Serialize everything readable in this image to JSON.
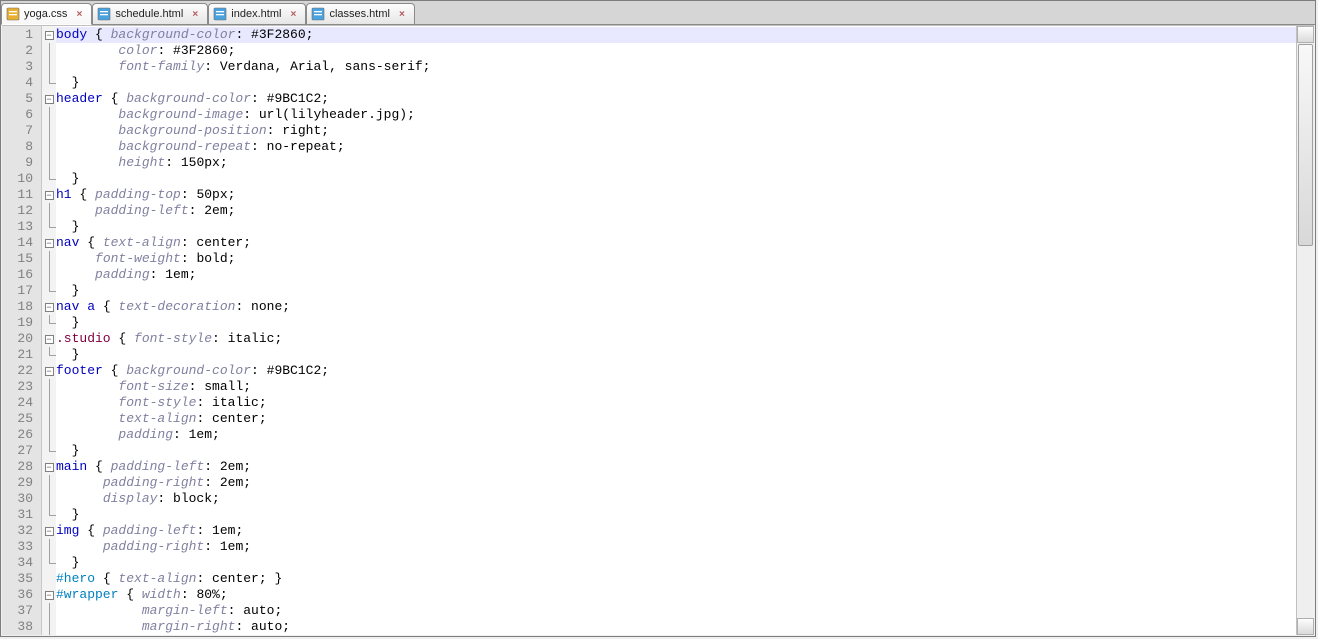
{
  "tabs": [
    {
      "name": "yoga.css",
      "active": true,
      "icontype": "css"
    },
    {
      "name": "schedule.html",
      "active": false,
      "icontype": "html"
    },
    {
      "name": "index.html",
      "active": false,
      "icontype": "html"
    },
    {
      "name": "classes.html",
      "active": false,
      "icontype": "html"
    }
  ],
  "line_count": 38,
  "code_lines": [
    {
      "n": 1,
      "fold": "open",
      "tokens": [
        [
          "sel",
          "body"
        ],
        [
          "plain",
          " { "
        ],
        [
          "prop",
          "background-color"
        ],
        [
          "plain",
          ": #3F2860;"
        ]
      ]
    },
    {
      "n": 2,
      "fold": "mid",
      "tokens": [
        [
          "plain",
          "        "
        ],
        [
          "prop",
          "color"
        ],
        [
          "plain",
          ": #3F2860;"
        ]
      ]
    },
    {
      "n": 3,
      "fold": "mid",
      "tokens": [
        [
          "plain",
          "        "
        ],
        [
          "prop",
          "font-family"
        ],
        [
          "plain",
          ": Verdana, Arial, sans-serif;"
        ]
      ]
    },
    {
      "n": 4,
      "fold": "end",
      "tokens": [
        [
          "plain",
          "  }"
        ]
      ]
    },
    {
      "n": 5,
      "fold": "open",
      "tokens": [
        [
          "sel",
          "header"
        ],
        [
          "plain",
          " { "
        ],
        [
          "prop",
          "background-color"
        ],
        [
          "plain",
          ": #9BC1C2;"
        ]
      ]
    },
    {
      "n": 6,
      "fold": "mid",
      "tokens": [
        [
          "plain",
          "        "
        ],
        [
          "prop",
          "background-image"
        ],
        [
          "plain",
          ": url(lilyheader.jpg);"
        ]
      ]
    },
    {
      "n": 7,
      "fold": "mid",
      "tokens": [
        [
          "plain",
          "        "
        ],
        [
          "prop",
          "background-position"
        ],
        [
          "plain",
          ": right;"
        ]
      ]
    },
    {
      "n": 8,
      "fold": "mid",
      "tokens": [
        [
          "plain",
          "        "
        ],
        [
          "prop",
          "background-repeat"
        ],
        [
          "plain",
          ": no-repeat;"
        ]
      ]
    },
    {
      "n": 9,
      "fold": "mid",
      "tokens": [
        [
          "plain",
          "        "
        ],
        [
          "prop",
          "height"
        ],
        [
          "plain",
          ": 150px;"
        ]
      ]
    },
    {
      "n": 10,
      "fold": "end",
      "tokens": [
        [
          "plain",
          "  }"
        ]
      ]
    },
    {
      "n": 11,
      "fold": "open",
      "tokens": [
        [
          "sel",
          "h1"
        ],
        [
          "plain",
          " { "
        ],
        [
          "prop",
          "padding-top"
        ],
        [
          "plain",
          ": 50px;"
        ]
      ]
    },
    {
      "n": 12,
      "fold": "mid",
      "tokens": [
        [
          "plain",
          "     "
        ],
        [
          "prop",
          "padding-left"
        ],
        [
          "plain",
          ": 2em;"
        ]
      ]
    },
    {
      "n": 13,
      "fold": "end",
      "tokens": [
        [
          "plain",
          "  }"
        ]
      ]
    },
    {
      "n": 14,
      "fold": "open",
      "tokens": [
        [
          "sel",
          "nav"
        ],
        [
          "plain",
          " { "
        ],
        [
          "prop",
          "text-align"
        ],
        [
          "plain",
          ": center;"
        ]
      ]
    },
    {
      "n": 15,
      "fold": "mid",
      "tokens": [
        [
          "plain",
          "     "
        ],
        [
          "prop",
          "font-weight"
        ],
        [
          "plain",
          ": bold;"
        ]
      ]
    },
    {
      "n": 16,
      "fold": "mid",
      "tokens": [
        [
          "plain",
          "     "
        ],
        [
          "prop",
          "padding"
        ],
        [
          "plain",
          ": 1em;"
        ]
      ]
    },
    {
      "n": 17,
      "fold": "end",
      "tokens": [
        [
          "plain",
          "  }"
        ]
      ]
    },
    {
      "n": 18,
      "fold": "open",
      "tokens": [
        [
          "sel",
          "nav a"
        ],
        [
          "plain",
          " { "
        ],
        [
          "prop",
          "text-decoration"
        ],
        [
          "plain",
          ": none;"
        ]
      ]
    },
    {
      "n": 19,
      "fold": "end",
      "tokens": [
        [
          "plain",
          "  }"
        ]
      ]
    },
    {
      "n": 20,
      "fold": "open",
      "tokens": [
        [
          "cls",
          ".studio"
        ],
        [
          "plain",
          " { "
        ],
        [
          "prop",
          "font-style"
        ],
        [
          "plain",
          ": italic;"
        ]
      ]
    },
    {
      "n": 21,
      "fold": "end",
      "tokens": [
        [
          "plain",
          "  }"
        ]
      ]
    },
    {
      "n": 22,
      "fold": "open",
      "tokens": [
        [
          "sel",
          "footer"
        ],
        [
          "plain",
          " { "
        ],
        [
          "prop",
          "background-color"
        ],
        [
          "plain",
          ": #9BC1C2;"
        ]
      ]
    },
    {
      "n": 23,
      "fold": "mid",
      "tokens": [
        [
          "plain",
          "        "
        ],
        [
          "prop",
          "font-size"
        ],
        [
          "plain",
          ": small;"
        ]
      ]
    },
    {
      "n": 24,
      "fold": "mid",
      "tokens": [
        [
          "plain",
          "        "
        ],
        [
          "prop",
          "font-style"
        ],
        [
          "plain",
          ": italic;"
        ]
      ]
    },
    {
      "n": 25,
      "fold": "mid",
      "tokens": [
        [
          "plain",
          "        "
        ],
        [
          "prop",
          "text-align"
        ],
        [
          "plain",
          ": center;"
        ]
      ]
    },
    {
      "n": 26,
      "fold": "mid",
      "tokens": [
        [
          "plain",
          "        "
        ],
        [
          "prop",
          "padding"
        ],
        [
          "plain",
          ": 1em;"
        ]
      ]
    },
    {
      "n": 27,
      "fold": "end",
      "tokens": [
        [
          "plain",
          "  }"
        ]
      ]
    },
    {
      "n": 28,
      "fold": "open",
      "tokens": [
        [
          "sel",
          "main"
        ],
        [
          "plain",
          " { "
        ],
        [
          "prop",
          "padding-left"
        ],
        [
          "plain",
          ": 2em;"
        ]
      ]
    },
    {
      "n": 29,
      "fold": "mid",
      "tokens": [
        [
          "plain",
          "      "
        ],
        [
          "prop",
          "padding-right"
        ],
        [
          "plain",
          ": 2em;"
        ]
      ]
    },
    {
      "n": 30,
      "fold": "mid",
      "tokens": [
        [
          "plain",
          "      "
        ],
        [
          "prop",
          "display"
        ],
        [
          "plain",
          ": block;"
        ]
      ]
    },
    {
      "n": 31,
      "fold": "end",
      "tokens": [
        [
          "plain",
          "  }"
        ]
      ]
    },
    {
      "n": 32,
      "fold": "open",
      "tokens": [
        [
          "sel",
          "img"
        ],
        [
          "plain",
          " { "
        ],
        [
          "prop",
          "padding-left"
        ],
        [
          "plain",
          ": 1em;"
        ]
      ]
    },
    {
      "n": 33,
      "fold": "mid",
      "tokens": [
        [
          "plain",
          "      "
        ],
        [
          "prop",
          "padding-right"
        ],
        [
          "plain",
          ": 1em;"
        ]
      ]
    },
    {
      "n": 34,
      "fold": "end",
      "tokens": [
        [
          "plain",
          "  }"
        ]
      ]
    },
    {
      "n": 35,
      "fold": "none",
      "tokens": [
        [
          "idsel",
          "#hero"
        ],
        [
          "plain",
          " { "
        ],
        [
          "prop",
          "text-align"
        ],
        [
          "plain",
          ": center; }"
        ]
      ]
    },
    {
      "n": 36,
      "fold": "open",
      "tokens": [
        [
          "idsel",
          "#wrapper"
        ],
        [
          "plain",
          " { "
        ],
        [
          "prop",
          "width"
        ],
        [
          "plain",
          ": 80%;"
        ]
      ]
    },
    {
      "n": 37,
      "fold": "mid",
      "tokens": [
        [
          "plain",
          "           "
        ],
        [
          "prop",
          "margin-left"
        ],
        [
          "plain",
          ": auto;"
        ]
      ]
    },
    {
      "n": 38,
      "fold": "mid",
      "tokens": [
        [
          "plain",
          "           "
        ],
        [
          "prop",
          "margin-right"
        ],
        [
          "plain",
          ": auto;"
        ]
      ]
    }
  ]
}
